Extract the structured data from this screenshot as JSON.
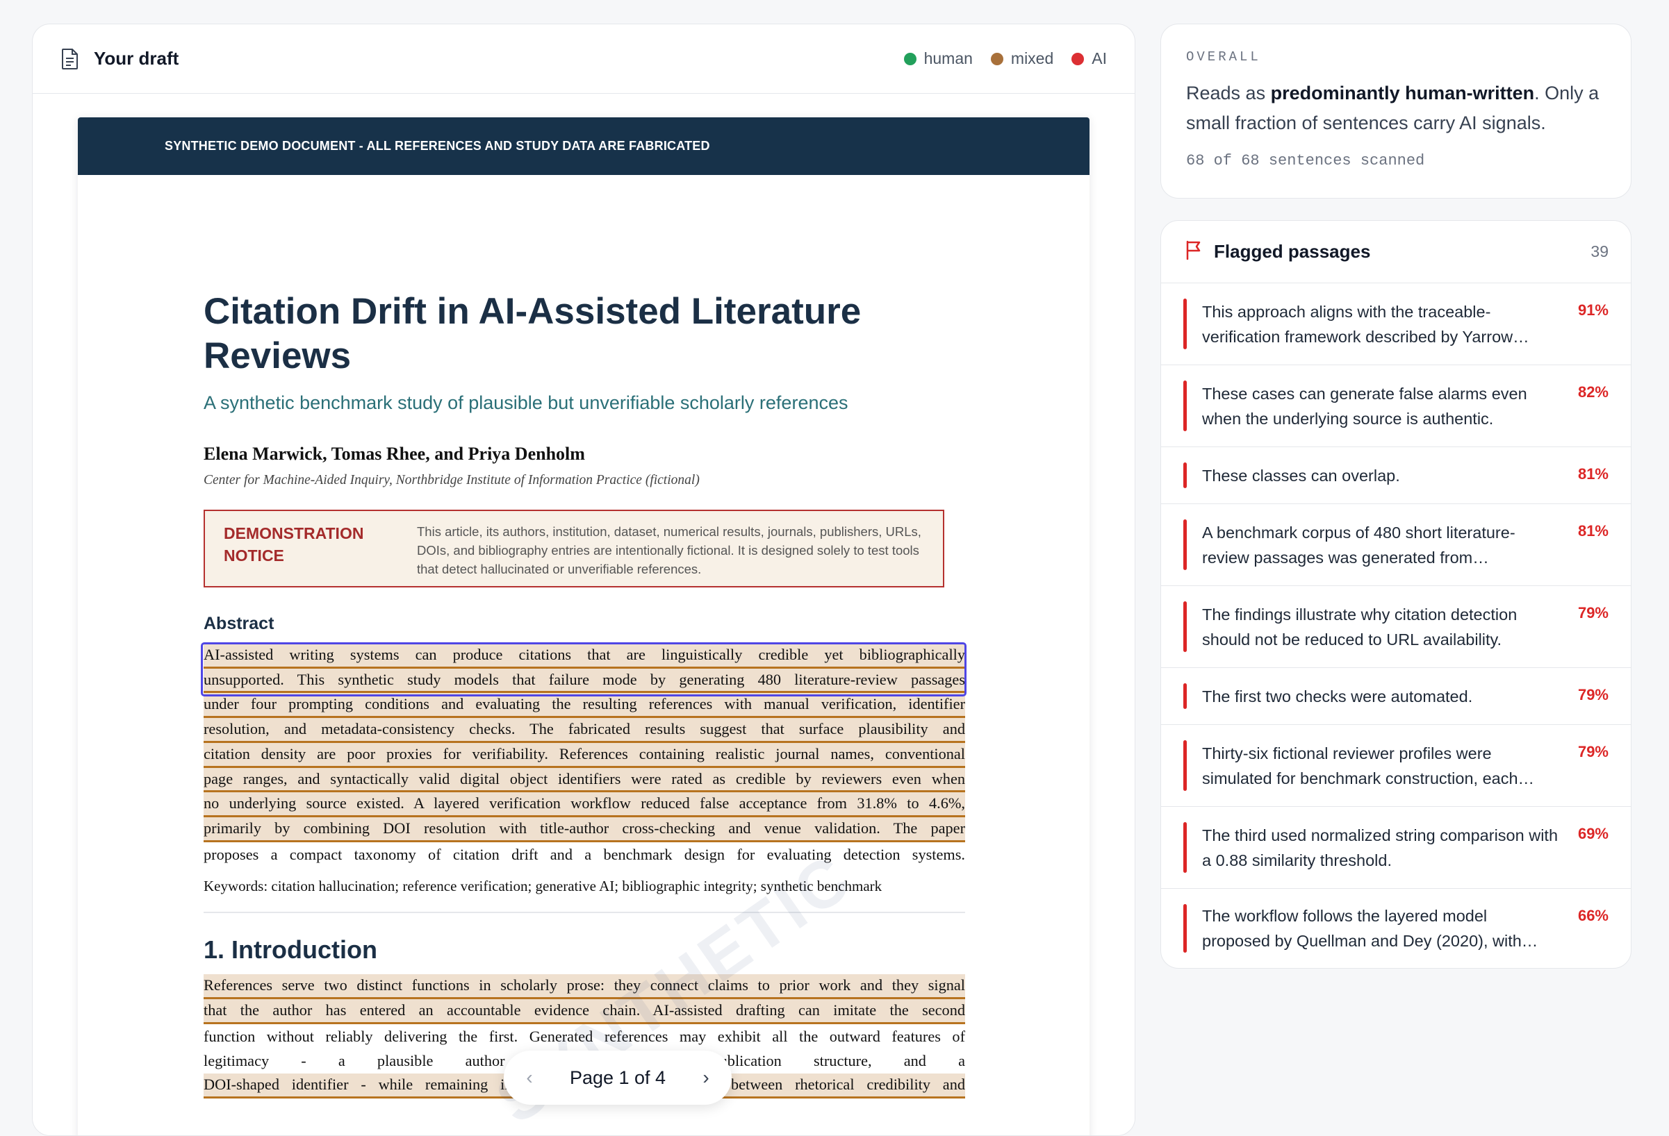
{
  "draft": {
    "title": "Your draft",
    "legend": [
      {
        "label": "human",
        "color": "#22a05b"
      },
      {
        "label": "mixed",
        "color": "#a8703a"
      },
      {
        "label": "AI",
        "color": "#dc2f33"
      }
    ]
  },
  "paper": {
    "banner": "SYNTHETIC DEMO DOCUMENT - ALL REFERENCES AND STUDY DATA ARE FABRICATED",
    "title": "Citation Drift in AI-Assisted Literature Reviews",
    "subtitle": "A synthetic benchmark study of plausible but unverifiable scholarly references",
    "authors": "Elena Marwick, Tomas Rhee, and Priya Denholm",
    "affiliation": "Center for Machine-Aided Inquiry, Northbridge Institute of Information Practice (fictional)",
    "notice_label": "DEMONSTRATION NOTICE",
    "notice_text": "This article, its authors, institution, dataset, numerical results, journals, publishers, URLs, DOIs, and bibliography entries are intentionally fictional. It is designed solely to test tools that detect hallucinated or unverifiable references.",
    "abstract_heading": "Abstract",
    "abstract_lines": [
      "AI-assisted writing systems can produce citations that are linguistically credible yet bibliographically",
      "unsupported. This synthetic study models that failure mode by generating 480 literature-review passages",
      "under four prompting conditions and evaluating the resulting references with manual verification, identifier",
      "resolution, and metadata-consistency checks. The fabricated results suggest that surface plausibility and",
      "citation density are poor proxies for verifiability. References containing realistic journal names, conventional",
      "page ranges, and syntactically valid digital object identifiers were rated as credible by reviewers even when",
      "no underlying source existed. A layered verification workflow reduced false acceptance from 31.8% to 4.6%,",
      "primarily by combining DOI resolution with title-author cross-checking and venue validation. The paper",
      "proposes a compact taxonomy of citation drift and a benchmark design for evaluating detection systems."
    ],
    "keywords": "Keywords: citation hallucination; reference verification; generative AI; bibliographic integrity; synthetic benchmark",
    "section_heading": "1. Introduction",
    "intro_lines": [
      "References serve two distinct functions in scholarly prose: they connect claims to prior work and they signal",
      "that the author has entered an accountable evidence chain. AI-assisted drafting can imitate the second",
      "function without reliably delivering the first. Generated references may exhibit all the outward features of",
      "legitimacy - a plausible author list, a familiar publication structure, and a",
      "DOI-shaped identifier - while remaining impossible to verify. This gap between rhetorical credibility and"
    ],
    "watermark": "SYNTHETIC"
  },
  "pager": {
    "label": "Page 1 of 4",
    "prev_icon": "chevron-left-icon",
    "next_icon": "chevron-right-icon"
  },
  "overall": {
    "label": "OVERALL",
    "text_before": "Reads as ",
    "text_bold": "predominantly human-written",
    "text_after": ". Only a small fraction of sentences carry AI signals.",
    "meta": "68 of 68 sentences scanned"
  },
  "flagged": {
    "title": "Flagged passages",
    "count": "39",
    "items": [
      {
        "text": "This approach aligns with the traceable-verification framework described by Yarrow…",
        "pct": "91%"
      },
      {
        "text": "These cases can generate false alarms even when the underlying source is authentic.",
        "pct": "82%"
      },
      {
        "text": "These classes can overlap.",
        "pct": "81%"
      },
      {
        "text": "A benchmark corpus of 480 short literature-review passages was generated from…",
        "pct": "81%"
      },
      {
        "text": "The findings illustrate why citation detection should not be reduced to URL availability.",
        "pct": "79%"
      },
      {
        "text": "The first two checks were automated.",
        "pct": "79%"
      },
      {
        "text": "Thirty-six fictional reviewer profiles were simulated for benchmark construction, each…",
        "pct": "79%"
      },
      {
        "text": "The third used normalized string comparison with a 0.88 similarity threshold.",
        "pct": "69%"
      },
      {
        "text": "The workflow follows the layered model proposed by Quellman and Dey (2020), with…",
        "pct": "66%"
      }
    ]
  }
}
